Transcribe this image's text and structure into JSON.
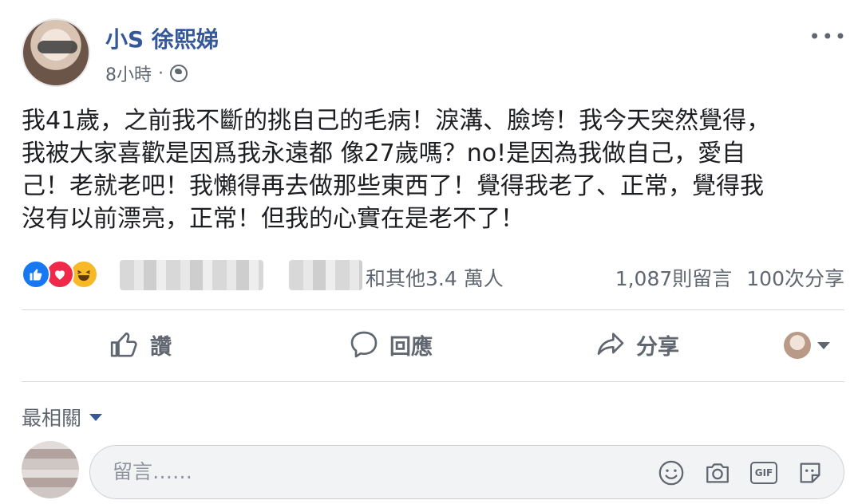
{
  "post": {
    "author": "小S 徐熙娣",
    "timestamp": "8小時",
    "privacy_icon": "globe-icon",
    "more_label": "•••",
    "text_lines": [
      "我41歲，之前我不斷的挑自己的毛病！淚溝、臉垮！我今天突然覺得，",
      "我被大家喜歡是因爲我永遠都 像27歲嗎？no!是因為我做自己，愛自",
      "己！老就老吧！我懶得再去做那些東西了！覺得我老了、正常，覺得我",
      "沒有以前漂亮，正常！但我的心實在是老不了！"
    ]
  },
  "reactions": {
    "types": [
      "like",
      "love",
      "haha"
    ],
    "others_text": "和其他3.4 萬人",
    "comments_count": "1,087則留言",
    "shares_count": "100次分享"
  },
  "actions": {
    "like_label": "讚",
    "comment_label": "回應",
    "share_label": "分享"
  },
  "comments": {
    "sort_label": "最相關",
    "input_placeholder": "留言……",
    "tools": [
      "emoji-icon",
      "camera-icon",
      "gif-icon",
      "sticker-icon"
    ],
    "gif_label": "GIF"
  },
  "colors": {
    "author": "#365899",
    "like_blue": "#1877f2",
    "love_red": "#f02849",
    "haha_yellow": "#f7b928"
  }
}
